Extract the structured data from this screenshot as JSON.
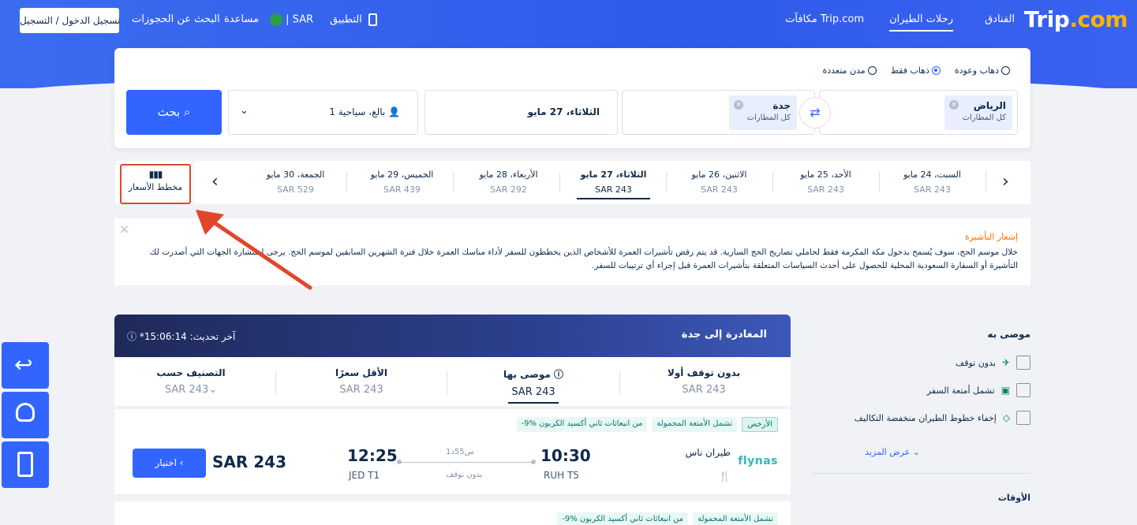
{
  "nav": {
    "logo": "Trip",
    "logo_suffix": ".com",
    "items": [
      "الفنادق",
      "رحلات الطيران",
      "مكافآت Trip.com"
    ],
    "app": "التطبيق",
    "currency": "SAR",
    "help": "مساعدة",
    "find_booking": "البحث عن الحجوزات",
    "login": "تسجيل الدخول / التسجيل"
  },
  "search": {
    "trip_types": [
      {
        "label": "ذهاب وعودة",
        "selected": false
      },
      {
        "label": "ذهاب فقط",
        "selected": true
      },
      {
        "label": "مدن متعددة",
        "selected": false
      }
    ],
    "from": {
      "city": "الرياض",
      "sub": "كل المطارات"
    },
    "to": {
      "city": "جدة",
      "sub": "كل المطارات"
    },
    "date": "الثلاثاء، 27 مايو",
    "passengers": "1 بالغ، سياحية",
    "button": "بحث"
  },
  "datebar": {
    "price_chart_label": "مخطط الأسعار",
    "dates": [
      {
        "day": "السبت، 24 مايو",
        "price": "SAR 243"
      },
      {
        "day": "الأحد، 25 مايو",
        "price": "SAR 243"
      },
      {
        "day": "الاثنين، 26 مايو",
        "price": "SAR 243"
      },
      {
        "day": "الثلاثاء، 27 مايو",
        "price": "SAR 243",
        "active": true
      },
      {
        "day": "الأربعاء، 28 مايو",
        "price": "SAR 292"
      },
      {
        "day": "الخميس، 29 مايو",
        "price": "SAR 439"
      },
      {
        "day": "الجمعة، 30 مايو",
        "price": "SAR 529"
      }
    ]
  },
  "notice": {
    "title": "إشعار التأشيرة",
    "text": "خلال موسم الحج، سوف يُسمح بدخول مكة المكرمة فقط لحاملي تصاريح الحج السارية. قد يتم رفض تأشيرات العمرة للأشخاص الذين يخططون للسفر لأداء مناسك العمرة خلال فترة الشهرين السابقين لموسم الحج. يرجى استشارة الجهات التي أصدرت لك التأشيرة أو السفارة السعودية المحلية للحصول على أحدث السياسات المتعلقة بتأشيرات العمرة قبل إجراء أي ترتيبات للسفر."
  },
  "results": {
    "destination": "المغادرة إلى جدة",
    "updated": "*آخر تحديث: 15:06:14",
    "sort": [
      {
        "label": "بدون توقف أولا",
        "value": "SAR 243"
      },
      {
        "label": "موصى بها",
        "value": "SAR 243",
        "active": true
      },
      {
        "label": "الأقل سعرًا",
        "value": "SAR 243"
      },
      {
        "label": "التصنيف حسب",
        "value": "SAR 243"
      }
    ],
    "flight": {
      "tags": [
        "الأرخص",
        "تشمل الأمتعة المحمولة",
        "-9% من انبعاثات ثاني أكسيد الكربون"
      ],
      "airline": "طيران ناس",
      "airline_logo": "flynas",
      "dep_time": "10:30",
      "dep_airport": "RUH T5",
      "arr_time": "12:25",
      "arr_airport": "JED T1",
      "duration": "1س55د",
      "stops": "بدون توقف",
      "price": "SAR 243",
      "choose": "اختيار"
    },
    "flight2_tags": [
      "تشمل الأمتعة المحمولة",
      "-9% من انبعاثات ثاني أكسيد الكربون"
    ]
  },
  "filters": {
    "heading": "موصى به",
    "items": [
      "بدون توقف",
      "تشمل أمتعة السفر",
      "إخفاء خطوط الطيران منخفضة التكاليف"
    ],
    "more": "عرض المزيد",
    "heading2": "الأوقات"
  },
  "colors": {
    "primary": "#3264ff",
    "annotation_arrow": "#e2462a",
    "eco": "#00816b"
  }
}
